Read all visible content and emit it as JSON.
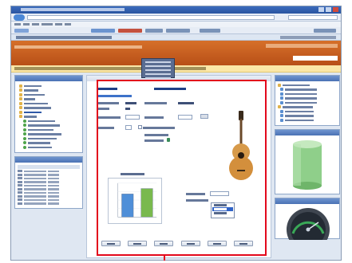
{
  "colors": {
    "app_header": "#c05a1e",
    "highlight": "#e3081c",
    "panel_header": "#5a80bf",
    "breadcrumb": "#fbe7a7"
  },
  "browser": {
    "icons": [
      "back-icon",
      "forward-icon",
      "refresh-icon",
      "search-icon",
      "home-icon",
      "close-icon"
    ]
  },
  "center": {
    "progress_label": "",
    "chart": {
      "title": "",
      "xlabel": "",
      "ylabel": ""
    },
    "listbox": {
      "options": [
        "",
        "",
        ""
      ],
      "selected_index": 1
    }
  },
  "chart_data": {
    "type": "bar",
    "categories": [
      "",
      ""
    ],
    "series": [
      {
        "values": [
          68,
          84
        ]
      }
    ],
    "ylim": [
      0,
      100
    ],
    "grid": true,
    "bar_colors": [
      "#4f8fd8",
      "#79b94e"
    ]
  }
}
